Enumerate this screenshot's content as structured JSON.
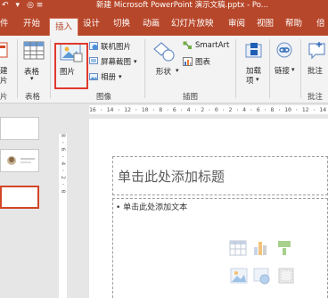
{
  "quick_access": {
    "undo": "↶",
    "dropdown": "▾",
    "extra": "◎  ≡"
  },
  "window": {
    "title": "新建 Microsoft PowerPoint 演示文稿.pptx - Po..."
  },
  "tabs": [
    {
      "label": "件",
      "active": false
    },
    {
      "label": "开始",
      "active": false
    },
    {
      "label": "插入",
      "active": true
    },
    {
      "label": "设计",
      "active": false
    },
    {
      "label": "切换",
      "active": false
    },
    {
      "label": "动画",
      "active": false
    },
    {
      "label": "幻灯片放映",
      "active": false
    },
    {
      "label": "审阅",
      "active": false
    },
    {
      "label": "视图",
      "active": false
    },
    {
      "label": "帮助",
      "active": false
    },
    {
      "label": "倍",
      "active": false
    }
  ],
  "ribbon": {
    "slides_group": {
      "new_label_1": "建",
      "new_label_2": "片",
      "group": "片"
    },
    "table": {
      "label": "表格",
      "arrow": "▾",
      "group": "表格"
    },
    "images": {
      "pictures": "图片",
      "online_pictures": "联机图片",
      "screenshot": "屏幕截图",
      "album": "相册",
      "group": "图像"
    },
    "illustrations": {
      "shapes": "形状",
      "smartart": "SmartArt",
      "chart": "图表",
      "group": "插图"
    },
    "addins": {
      "label1": "加载",
      "label2": "项",
      "arrow": "▾"
    },
    "links": {
      "label": "链接",
      "arrow": "▾"
    },
    "comments": {
      "label": "批注",
      "group": "批注"
    }
  },
  "ruler": {
    "horizontal": "16 · 14 · 12 · 10 · 8 · 6 · 4 · 2 · 0 · 2 · 4 · 6 · 8 · 10 · 12 · 14 · 16",
    "vertical": "8 · 6 · 4 · 2 · 0"
  },
  "slide": {
    "title_placeholder": "单击此处添加标题",
    "body_placeholder": "• 单击此处添加文本"
  },
  "thumbnails": [
    {
      "index": 1,
      "selected": false
    },
    {
      "index": 2,
      "selected": false
    },
    {
      "index": 3,
      "selected": true
    }
  ],
  "colors": {
    "accent": "#b7472a",
    "highlight": "#e03a2f",
    "ribbon_bg": "#f3f3f3"
  }
}
